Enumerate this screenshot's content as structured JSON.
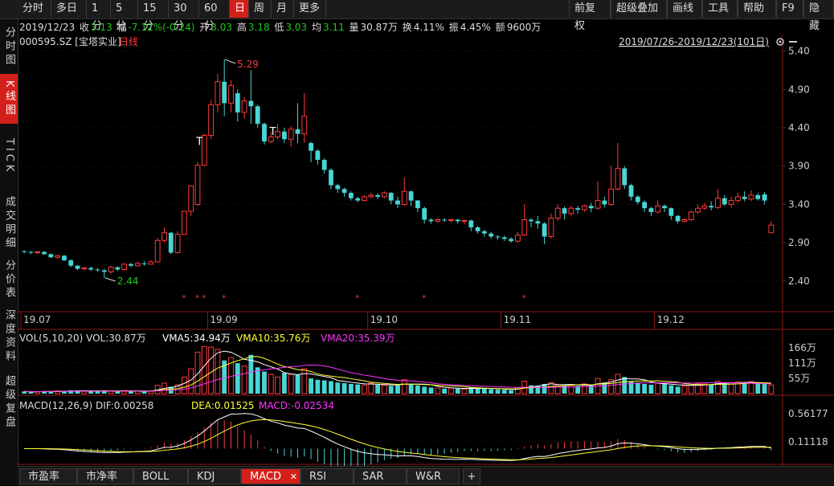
{
  "toolbar": {
    "items": [
      "分时",
      "多日",
      "1分",
      "5分",
      "15分",
      "30分",
      "60分",
      "日",
      "周",
      "月",
      "更多"
    ],
    "active": "日",
    "right_items": [
      "前复权",
      "超级叠加",
      "画线",
      "工具",
      "帮助",
      "F9",
      "隐藏"
    ]
  },
  "sidebar": {
    "items": [
      "分时图",
      "K线图",
      "TICK",
      "成交明细",
      "分价表",
      "深度资料",
      "超级复盘"
    ],
    "active": "K线图"
  },
  "info": {
    "date": "2019/12/23",
    "close_label": "收",
    "close": "3.13",
    "change_label": "幅",
    "change": "-7.12%(-0.24)",
    "open_label": "开",
    "open": "3.03",
    "high_label": "高",
    "high": "3.18",
    "low_label": "低",
    "low": "3.03",
    "avg_label": "均",
    "avg": "3.11",
    "vol_label": "量",
    "vol": "30.87万",
    "turnover_label": "换",
    "turnover": "4.11%",
    "amplitude_label": "振",
    "amplitude": "4.45%",
    "amount_label": "额",
    "amount": "9600万"
  },
  "stock": {
    "code_name": "000595.SZ [宝塔实业]",
    "period": "日线"
  },
  "range_label": "2019/07/26-2019/12/23(101日)",
  "price_labels": {
    "high": "5.29",
    "low": "2.44"
  },
  "vol_panel": {
    "title": "VOL(5,10,20) VOL:30.87万",
    "vma5": "VMA5:34.94万",
    "vma10": "VMA10:35.76万",
    "vma20": "VMA20:35.39万",
    "axis": [
      "166万",
      "111万",
      "55万"
    ]
  },
  "macd_panel": {
    "title": "MACD(12,26,9) DIF:0.00258",
    "dea": "DEA:0.01525",
    "macd": "MACD:-0.02534",
    "axis": [
      "0.56177",
      "0.11118"
    ]
  },
  "bottom_tabs": [
    "市盈率",
    "市净率",
    "BOLL",
    "KDJ",
    "MACD",
    "RSI",
    "SAR",
    "W&R"
  ],
  "bottom_active": "MACD",
  "colors": {
    "up": "#ff3a3a",
    "down": "#47d6d6",
    "bg": "#000000",
    "accent": "#d4201b",
    "ma5": "#ffffff",
    "ma10": "#ffff33",
    "ma20": "#ff33ff"
  },
  "chart_data": [
    {
      "type": "candlestick",
      "title": "000595.SZ [宝塔实业] 日线",
      "x_ticks": [
        "19.07",
        "19.09",
        "19.10",
        "19.11",
        "19.12"
      ],
      "y_ticks": [
        5.4,
        4.9,
        4.4,
        3.9,
        3.4,
        2.9,
        2.4
      ],
      "ylim": [
        2.0,
        5.5
      ],
      "annotations": [
        {
          "label": "5.29",
          "type": "max"
        },
        {
          "label": "2.44",
          "type": "min"
        }
      ],
      "candles": [
        [
          2.79,
          2.78,
          2.8,
          2.76
        ],
        [
          2.78,
          2.77,
          2.79,
          2.75
        ],
        [
          2.77,
          2.78,
          2.79,
          2.75
        ],
        [
          2.78,
          2.75,
          2.79,
          2.74
        ],
        [
          2.75,
          2.71,
          2.76,
          2.7
        ],
        [
          2.71,
          2.73,
          2.74,
          2.69
        ],
        [
          2.73,
          2.67,
          2.74,
          2.66
        ],
        [
          2.67,
          2.6,
          2.68,
          2.58
        ],
        [
          2.6,
          2.56,
          2.61,
          2.54
        ],
        [
          2.56,
          2.57,
          2.58,
          2.54
        ],
        [
          2.57,
          2.55,
          2.59,
          2.53
        ],
        [
          2.55,
          2.54,
          2.57,
          2.52
        ],
        [
          2.54,
          2.52,
          2.56,
          2.44
        ],
        [
          2.52,
          2.58,
          2.6,
          2.5
        ],
        [
          2.58,
          2.55,
          2.59,
          2.53
        ],
        [
          2.55,
          2.62,
          2.63,
          2.53
        ],
        [
          2.62,
          2.6,
          2.64,
          2.58
        ],
        [
          2.6,
          2.63,
          2.65,
          2.59
        ],
        [
          2.63,
          2.62,
          2.66,
          2.6
        ],
        [
          2.62,
          2.65,
          2.67,
          2.61
        ],
        [
          2.65,
          2.93,
          2.96,
          2.64
        ],
        [
          2.93,
          3.03,
          3.1,
          2.9
        ],
        [
          3.03,
          2.77,
          3.04,
          2.75
        ],
        [
          2.77,
          3.01,
          3.05,
          2.76
        ],
        [
          3.01,
          3.31,
          3.31,
          3.01
        ],
        [
          3.31,
          3.64,
          3.64,
          3.25
        ],
        [
          3.4,
          3.91,
          3.95,
          3.38
        ],
        [
          3.91,
          4.3,
          4.32,
          3.9
        ],
        [
          4.3,
          4.7,
          4.76,
          4.25
        ],
        [
          4.7,
          5.0,
          5.1,
          4.6
        ],
        [
          5.0,
          4.72,
          5.29,
          4.55
        ],
        [
          4.72,
          4.95,
          5.02,
          4.6
        ],
        [
          4.85,
          4.6,
          4.9,
          4.48
        ],
        [
          4.6,
          4.75,
          4.8,
          4.52
        ],
        [
          4.75,
          4.68,
          5.15,
          4.45
        ],
        [
          4.68,
          4.45,
          4.7,
          4.4
        ],
        [
          4.45,
          4.22,
          4.47,
          4.18
        ],
        [
          4.22,
          4.28,
          4.35,
          4.2
        ],
        [
          4.28,
          4.35,
          4.45,
          4.25
        ],
        [
          4.35,
          4.25,
          4.4,
          4.2
        ],
        [
          4.25,
          4.38,
          4.42,
          4.15
        ],
        [
          4.38,
          4.32,
          4.72,
          4.2
        ],
        [
          4.32,
          4.55,
          4.85,
          4.2
        ],
        [
          4.2,
          4.1,
          4.22,
          3.95
        ],
        [
          4.1,
          3.98,
          4.12,
          3.92
        ],
        [
          3.98,
          3.85,
          4.0,
          3.8
        ],
        [
          3.85,
          3.65,
          3.87,
          3.6
        ],
        [
          3.65,
          3.6,
          3.67,
          3.55
        ],
        [
          3.6,
          3.55,
          3.62,
          3.5
        ],
        [
          3.55,
          3.48,
          3.57,
          3.45
        ],
        [
          3.48,
          3.45,
          3.5,
          3.43
        ],
        [
          3.45,
          3.5,
          3.52,
          3.44
        ],
        [
          3.5,
          3.52,
          3.55,
          3.48
        ],
        [
          3.52,
          3.5,
          3.54,
          3.47
        ],
        [
          3.5,
          3.55,
          3.57,
          3.48
        ],
        [
          3.55,
          3.45,
          3.56,
          3.4
        ],
        [
          3.45,
          3.4,
          3.5,
          3.35
        ],
        [
          3.4,
          3.57,
          3.75,
          3.38
        ],
        [
          3.57,
          3.45,
          3.58,
          3.38
        ],
        [
          3.45,
          3.35,
          3.46,
          3.3
        ],
        [
          3.35,
          3.2,
          3.37,
          3.15
        ],
        [
          3.2,
          3.18,
          3.22,
          3.15
        ],
        [
          3.18,
          3.2,
          3.22,
          3.16
        ],
        [
          3.2,
          3.19,
          3.22,
          3.17
        ],
        [
          3.19,
          3.2,
          3.21,
          3.16
        ],
        [
          3.2,
          3.18,
          3.21,
          3.15
        ],
        [
          3.18,
          3.19,
          3.2,
          3.14
        ],
        [
          3.19,
          3.1,
          3.2,
          3.05
        ],
        [
          3.1,
          3.05,
          3.12,
          3.02
        ],
        [
          3.05,
          3.02,
          3.07,
          2.98
        ],
        [
          3.02,
          2.98,
          3.04,
          2.95
        ],
        [
          2.98,
          2.97,
          3.0,
          2.94
        ],
        [
          2.97,
          2.95,
          2.99,
          2.92
        ],
        [
          2.95,
          2.92,
          2.97,
          2.9
        ],
        [
          2.92,
          3.0,
          3.04,
          2.9
        ],
        [
          3.0,
          3.2,
          3.4,
          2.99
        ],
        [
          3.2,
          3.18,
          3.22,
          3.1
        ],
        [
          3.18,
          3.15,
          3.25,
          3.08
        ],
        [
          3.15,
          2.98,
          3.17,
          2.88
        ],
        [
          2.98,
          3.22,
          3.28,
          2.95
        ],
        [
          3.22,
          3.35,
          3.4,
          3.18
        ],
        [
          3.35,
          3.28,
          3.37,
          3.2
        ],
        [
          3.28,
          3.35,
          3.38,
          3.25
        ],
        [
          3.35,
          3.33,
          3.38,
          3.28
        ],
        [
          3.33,
          3.38,
          3.4,
          3.3
        ],
        [
          3.38,
          3.35,
          3.42,
          3.3
        ],
        [
          3.35,
          3.45,
          3.7,
          3.33
        ],
        [
          3.45,
          3.4,
          3.5,
          3.36
        ],
        [
          3.4,
          3.6,
          3.9,
          3.38
        ],
        [
          3.6,
          3.87,
          4.2,
          3.58
        ],
        [
          3.87,
          3.65,
          3.9,
          3.6
        ],
        [
          3.65,
          3.5,
          3.67,
          3.45
        ],
        [
          3.5,
          3.43,
          3.52,
          3.4
        ],
        [
          3.43,
          3.35,
          3.45,
          3.3
        ],
        [
          3.35,
          3.3,
          3.37,
          3.25
        ],
        [
          3.3,
          3.38,
          3.45,
          3.28
        ],
        [
          3.38,
          3.35,
          3.4,
          3.3
        ],
        [
          3.35,
          3.25,
          3.36,
          3.2
        ],
        [
          3.25,
          3.18,
          3.26,
          3.15
        ],
        [
          3.18,
          3.2,
          3.22,
          3.16
        ],
        [
          3.2,
          3.3,
          3.32,
          3.18
        ],
        [
          3.3,
          3.35,
          3.4,
          3.28
        ],
        [
          3.35,
          3.38,
          3.42,
          3.33
        ],
        [
          3.38,
          3.36,
          3.44,
          3.32
        ],
        [
          3.36,
          3.48,
          3.6,
          3.34
        ],
        [
          3.48,
          3.4,
          3.52,
          3.38
        ],
        [
          3.4,
          3.45,
          3.5,
          3.36
        ],
        [
          3.45,
          3.5,
          3.55,
          3.42
        ],
        [
          3.5,
          3.47,
          3.57,
          3.44
        ],
        [
          3.47,
          3.52,
          3.58,
          3.44
        ],
        [
          3.52,
          3.47,
          3.55,
          3.45
        ],
        [
          3.53,
          3.45,
          3.56,
          3.4
        ],
        [
          3.03,
          3.13,
          3.18,
          3.03
        ]
      ],
      "marks": [
        {
          "x_index": 27,
          "label": "T"
        },
        {
          "x_index": 38,
          "label": "T"
        }
      ]
    },
    {
      "type": "bar",
      "title": "VOL(5,10,20)",
      "ylim": [
        0,
        180
      ],
      "values": [
        8,
        6,
        7,
        9,
        8,
        10,
        9,
        12,
        11,
        10,
        9,
        8,
        12,
        10,
        8,
        11,
        9,
        10,
        8,
        9,
        30,
        38,
        25,
        32,
        60,
        90,
        150,
        170,
        168,
        160,
        120,
        130,
        110,
        100,
        140,
        95,
        80,
        70,
        60,
        75,
        70,
        68,
        90,
        55,
        50,
        48,
        45,
        40,
        38,
        35,
        33,
        30,
        38,
        32,
        30,
        28,
        30,
        50,
        35,
        30,
        25,
        22,
        20,
        18,
        20,
        18,
        16,
        22,
        20,
        18,
        16,
        15,
        14,
        12,
        22,
        45,
        30,
        28,
        35,
        40,
        32,
        28,
        30,
        28,
        35,
        30,
        55,
        40,
        50,
        70,
        60,
        45,
        40,
        35,
        32,
        38,
        35,
        30,
        25,
        28,
        30,
        35,
        38,
        32,
        45,
        38,
        40,
        42,
        38,
        44,
        36,
        35,
        31
      ],
      "series_lines": [
        {
          "name": "VMA5",
          "color": "#ffffff"
        },
        {
          "name": "VMA10",
          "color": "#ffff33"
        },
        {
          "name": "VMA20",
          "color": "#ff33ff"
        }
      ]
    },
    {
      "type": "histogram",
      "title": "MACD(12,26,9)",
      "ylim": [
        -0.2,
        0.6
      ],
      "series_lines": [
        {
          "name": "DIF",
          "color": "#ffffff"
        },
        {
          "name": "DEA",
          "color": "#ffff33"
        }
      ]
    }
  ]
}
